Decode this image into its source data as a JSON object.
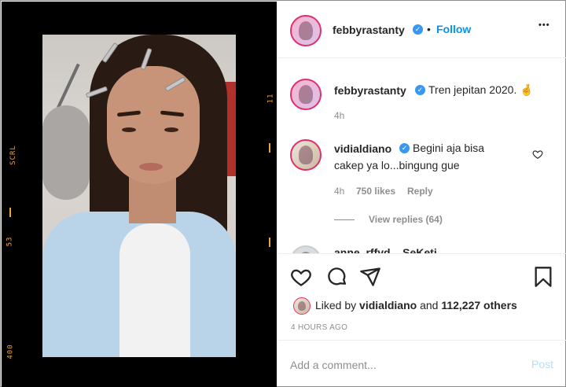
{
  "film": {
    "left_top": "SCRL",
    "left_mid": "53",
    "left_bot": "400",
    "right_top": "11"
  },
  "header": {
    "username": "febbyrastanty",
    "separator": "•",
    "follow_label": "Follow",
    "more_label": "•••"
  },
  "caption": {
    "username": "febbyrastanty",
    "text": "Tren jepitan 2020. 🤞",
    "time": "4h"
  },
  "comment": {
    "username": "vidialdiano",
    "text_line1": "Begini aja bisa",
    "text_line2": "cakep ya lo...bingung gue",
    "time": "4h",
    "likes": "750 likes",
    "reply_label": "Reply",
    "view_replies": "View replies (64)"
  },
  "next_comment": {
    "partial_text": "anne_rffyd... SeKeti..."
  },
  "likes_row": {
    "prefix": "Liked by",
    "user": "vidialdiano",
    "middle": "and",
    "others": "112,227 others"
  },
  "timestamp": "4 HOURS AGO",
  "composer": {
    "placeholder": "Add a comment...",
    "post_label": "Post"
  },
  "colors": {
    "follow": "#0095f6",
    "verified": "#3897f0",
    "post_disabled": "#b2dffc",
    "film_accent": "#f0a23a"
  }
}
